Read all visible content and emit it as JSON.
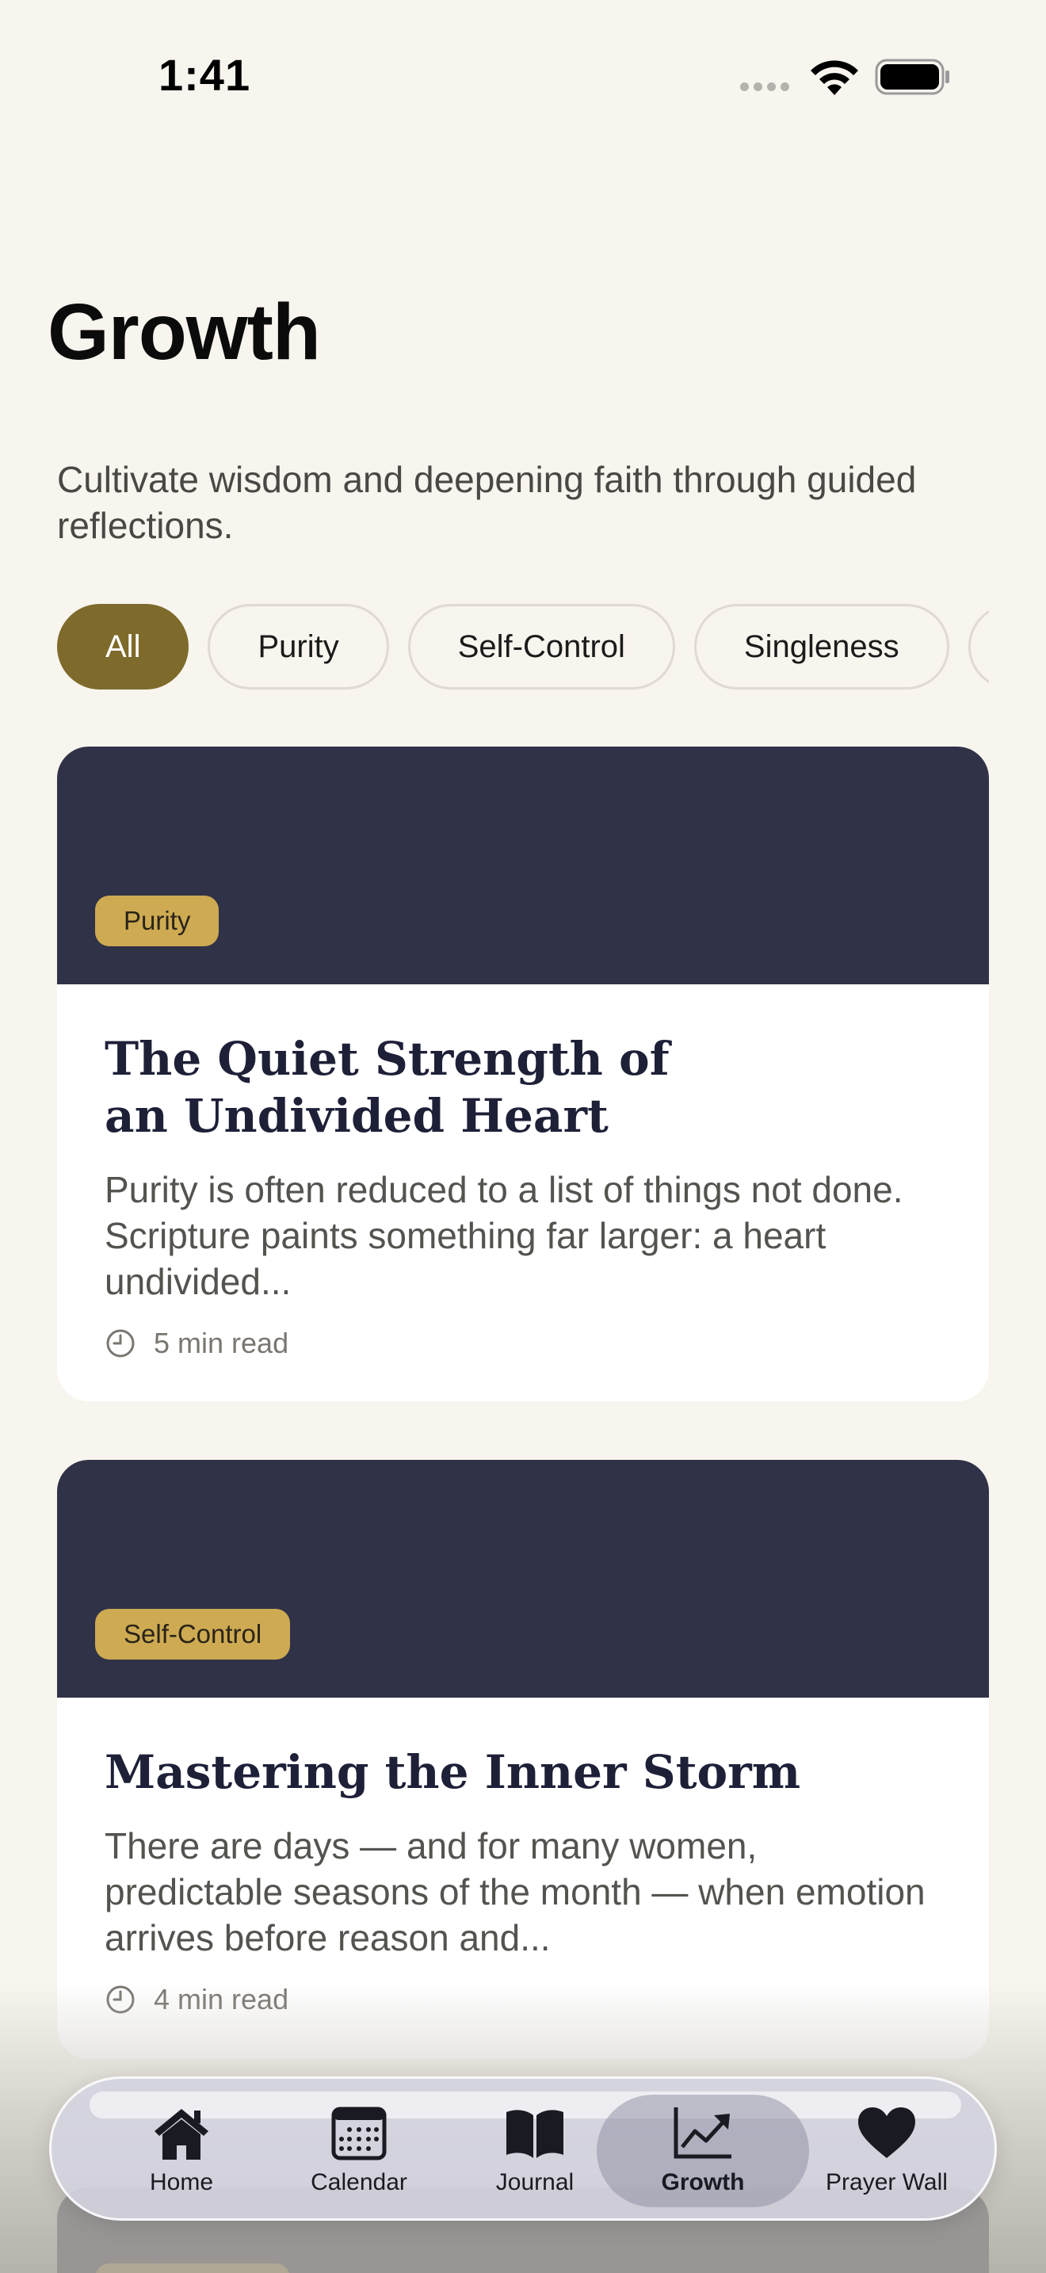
{
  "status_bar": {
    "time": "1:41"
  },
  "header": {
    "title": "Growth",
    "subtitle": "Cultivate wisdom and deepening faith through guided reflections."
  },
  "filters": [
    {
      "label": "All",
      "selected": true
    },
    {
      "label": "Purity",
      "selected": false
    },
    {
      "label": "Self-Control",
      "selected": false
    },
    {
      "label": "Singleness",
      "selected": false
    }
  ],
  "articles": [
    {
      "tag": "Purity",
      "title": "The Quiet Strength of an Undivided Heart",
      "excerpt": "Purity is often reduced to a list of things not done. Scripture paints something far larger: a heart undivided...",
      "read_time": "5 min read"
    },
    {
      "tag": "Self-Control",
      "title": "Mastering the Inner Storm",
      "excerpt": "There are days — and for many women, predictable seasons of the month — when emotion arrives before reason and...",
      "read_time": "4 min read"
    }
  ],
  "tab_bar": [
    {
      "label": "Home",
      "icon": "house-icon",
      "active": false
    },
    {
      "label": "Calendar",
      "icon": "calendar-icon",
      "active": false
    },
    {
      "label": "Journal",
      "icon": "book-icon",
      "active": false
    },
    {
      "label": "Growth",
      "icon": "chart-trend-icon",
      "active": true
    },
    {
      "label": "Prayer Wall",
      "icon": "heart-icon",
      "active": false
    }
  ],
  "colors": {
    "background": "#f8f4ee",
    "accent": "#7e6a2a",
    "card_banner": "#303247",
    "tag": "#ceaa52",
    "title_navy": "#1e2038"
  }
}
